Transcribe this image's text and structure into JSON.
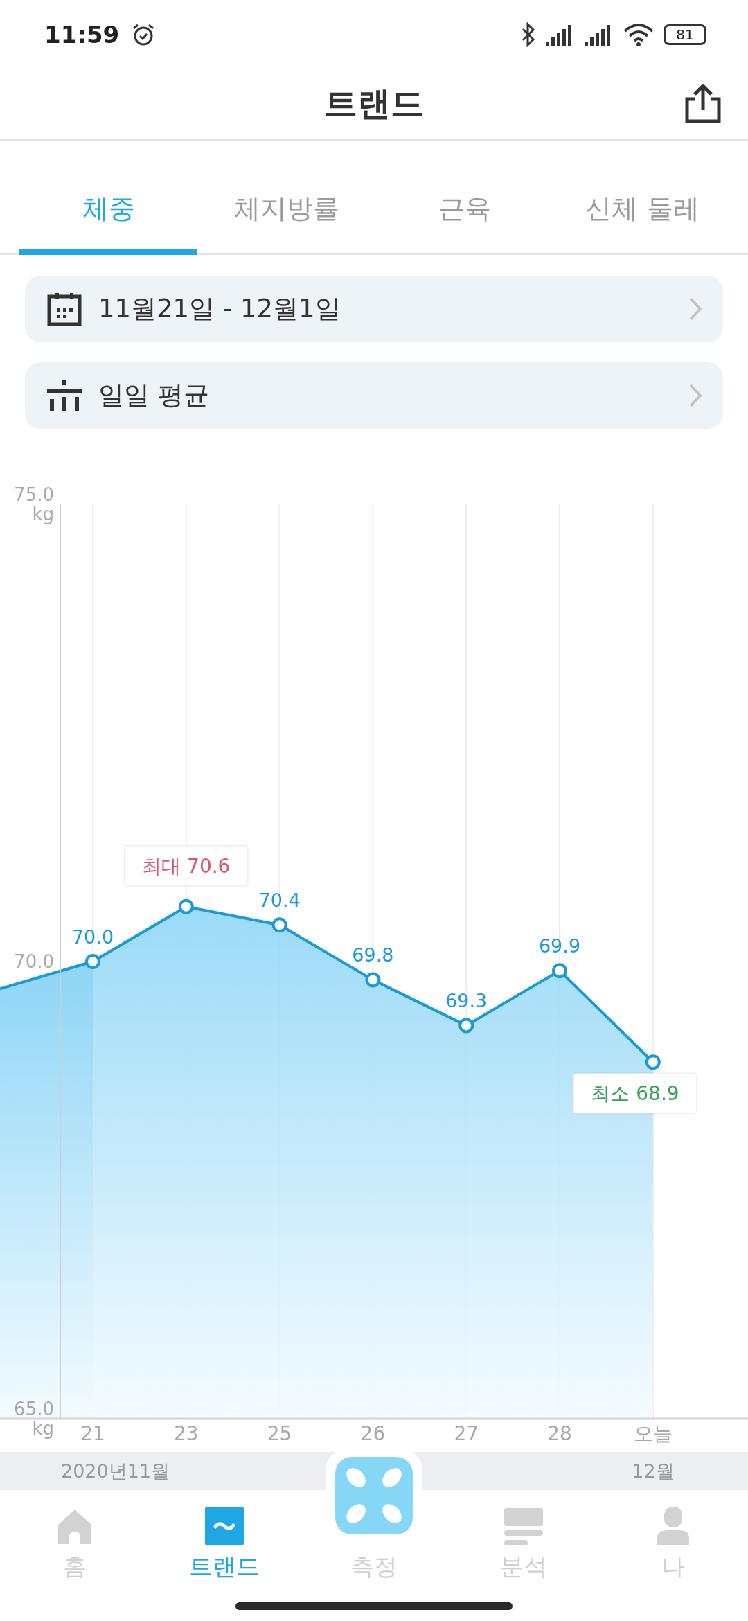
{
  "status_bar": {
    "time": "11:59",
    "battery": "81"
  },
  "header": {
    "title": "트랜드"
  },
  "tabs": [
    {
      "label": "체중",
      "selected": true
    },
    {
      "label": "체지방률",
      "selected": false
    },
    {
      "label": "근육",
      "selected": false
    },
    {
      "label": "신체 둘레",
      "selected": false
    }
  ],
  "filters": [
    {
      "kind": "date",
      "label": "11월21일 - 12월1일"
    },
    {
      "kind": "average",
      "label": "일일 평균"
    }
  ],
  "chart": {
    "chart_data": {
      "type": "area",
      "categories": [
        "21",
        "23",
        "25",
        "26",
        "27",
        "28",
        "오늘"
      ],
      "series": [
        {
          "color": "#1a9ad6",
          "values": [
            70.0,
            70.6,
            70.4,
            69.8,
            69.3,
            69.9,
            68.9
          ]
        }
      ],
      "ylim": [
        65,
        75
      ],
      "yticks": [
        {
          "value": 75,
          "label": "75.0 kg"
        },
        {
          "value": 70,
          "label": "70.0"
        },
        {
          "value": 65,
          "label": "65.0 kg"
        }
      ],
      "grid": true,
      "value_labels": [
        "70.0",
        null,
        "70.4",
        "69.8",
        "69.3",
        "69.9",
        null
      ],
      "annotations": [
        {
          "x": "23",
          "y": 70.6,
          "text": "최대 70.6"
        },
        {
          "x": "오늘",
          "y": 68.9,
          "text": "최소 68.9"
        }
      ]
    }
  },
  "month_bar": {
    "start": "2020년11월",
    "end": "12월"
  },
  "nav": [
    {
      "kind": "home",
      "label": "홈",
      "selected": false
    },
    {
      "kind": "trend",
      "label": "트랜드",
      "selected": true
    },
    {
      "kind": "measure",
      "label": "측정",
      "selected": false
    },
    {
      "kind": "analysis",
      "label": "분석",
      "selected": false
    },
    {
      "kind": "me",
      "label": "나",
      "selected": false
    }
  ]
}
